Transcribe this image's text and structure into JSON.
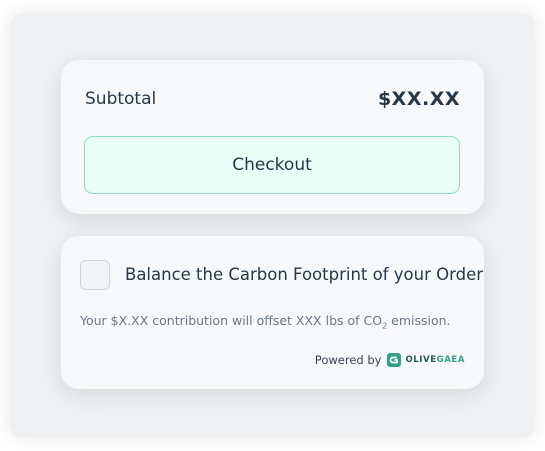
{
  "cart": {
    "subtotal_label": "Subtotal",
    "subtotal_value": "$XX.XX",
    "checkout_label": "Checkout"
  },
  "offset": {
    "checkbox_label": "Balance the Carbon Footprint of your Order",
    "contribution_prefix": "Your $X.XX contribution will offset XXX lbs of CO",
    "contribution_sub": "2",
    "contribution_suffix": " emission.",
    "checked": false,
    "powered_by": "Powered by",
    "brand_part1": "OLIVE",
    "brand_part2": "GAEA",
    "brand_icon": "olivegaea-logo-icon"
  },
  "colors": {
    "accent_border": "#8fdcc6",
    "accent_fill": "#eafdf7",
    "text_dark": "#263848",
    "brand_dark": "#1f5c4d",
    "brand_light": "#2fa387"
  }
}
